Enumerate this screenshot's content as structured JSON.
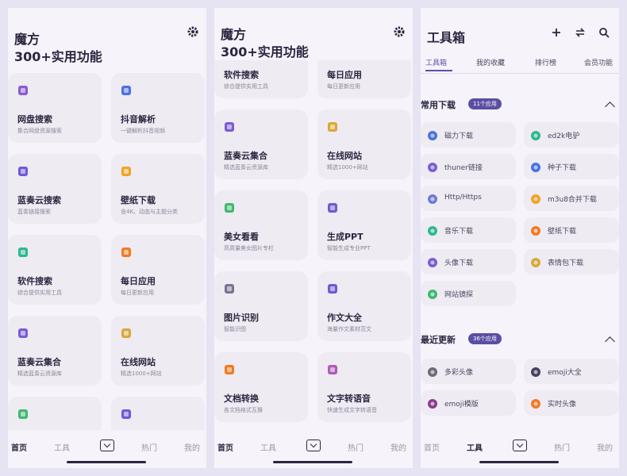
{
  "screen1": {
    "title_line1": "魔方",
    "title_line2": "300+实用功能",
    "cards": [
      {
        "title": "网盘搜索",
        "sub": "集合网盘资源搜索",
        "icon": "inbox-icon",
        "color": "#8a5cd0"
      },
      {
        "title": "抖音解析",
        "sub": "一键解析抖音视频",
        "icon": "music-note-icon",
        "color": "#4a72e0"
      },
      {
        "title": "蓝奏云搜索",
        "sub": "蓝奏链接搜索",
        "icon": "cloud-icon",
        "color": "#6e5ad6"
      },
      {
        "title": "壁纸下载",
        "sub": "含4K、动态与主题分类",
        "icon": "image-icon",
        "color": "#f2a226"
      },
      {
        "title": "软件搜索",
        "sub": "综合提供实用工具",
        "icon": "database-icon",
        "color": "#2cb894"
      },
      {
        "title": "每日应用",
        "sub": "每日更新应用",
        "icon": "cube-icon",
        "color": "#f07a22"
      },
      {
        "title": "蓝奏云集合",
        "sub": "精选蓝奏云资源库",
        "icon": "folder-icon",
        "color": "#7a5cd6"
      },
      {
        "title": "在线网站",
        "sub": "精选1000+网站",
        "icon": "globe-icon",
        "color": "#d8a83a"
      },
      {
        "title": "",
        "sub": "",
        "icon": "eye-icon",
        "color": "#3fb870"
      },
      {
        "title": "",
        "sub": "",
        "icon": "pie-icon",
        "color": "#6e5ad6"
      }
    ],
    "nav": [
      "首页",
      "工具",
      "热门",
      "我的"
    ]
  },
  "screen2": {
    "title_line1": "魔方",
    "title_line2": "300+实用功能",
    "cards": [
      {
        "title": "软件搜索",
        "sub": "综合提供实用工具",
        "icon": "database-icon",
        "color": "#2cb894"
      },
      {
        "title": "每日应用",
        "sub": "每日更新应用",
        "icon": "cube-icon",
        "color": "#f07a22"
      },
      {
        "title": "蓝奏云集合",
        "sub": "精选蓝奏云资源库",
        "icon": "folder-icon",
        "color": "#7a5cd6"
      },
      {
        "title": "在线网站",
        "sub": "精选1000+网站",
        "icon": "globe-icon",
        "color": "#d8a83a"
      },
      {
        "title": "美女看看",
        "sub": "高质量美女图片专栏",
        "icon": "eye-icon",
        "color": "#3fb870"
      },
      {
        "title": "生成PPT",
        "sub": "智能生成专业PPT",
        "icon": "pie-icon",
        "color": "#6e5ad6"
      },
      {
        "title": "图片识别",
        "sub": "智能识图",
        "icon": "scan-icon",
        "color": "#7a7390"
      },
      {
        "title": "作文大全",
        "sub": "海量作文素材范文",
        "icon": "document-icon",
        "color": "#6e5ad6"
      },
      {
        "title": "文档转换",
        "sub": "各文档格式互换",
        "icon": "file-icon",
        "color": "#f07a22"
      },
      {
        "title": "文字转语音",
        "sub": "快速生成文字转语音",
        "icon": "mic-icon",
        "color": "#b05ab8"
      }
    ],
    "nav": [
      "首页",
      "工具",
      "热门",
      "我的"
    ]
  },
  "screen3": {
    "title": "工具箱",
    "tabs": [
      "工具箱",
      "我的收藏",
      "排行榜",
      "会员功能"
    ],
    "section1": {
      "title": "常用下载",
      "badge": "11个应用",
      "items": [
        {
          "label": "磁力下载",
          "icon": "magnet-icon",
          "color": "#4a72e0"
        },
        {
          "label": "ed2k电驴",
          "icon": "medal-icon",
          "color": "#2cb894"
        },
        {
          "label": "thuner链接",
          "icon": "bird-icon",
          "color": "#7a5cd6"
        },
        {
          "label": "种子下载",
          "icon": "cloud-icon",
          "color": "#4a72e0"
        },
        {
          "label": "Http/Https",
          "icon": "globe-icon",
          "color": "#6e7ad6"
        },
        {
          "label": "m3u8合并下载",
          "icon": "video-icon",
          "color": "#f2a226"
        },
        {
          "label": "音乐下载",
          "icon": "music-note-icon",
          "color": "#2cb894"
        },
        {
          "label": "壁纸下载",
          "icon": "image-icon",
          "color": "#f07a22"
        },
        {
          "label": "头像下载",
          "icon": "avatar-icon",
          "color": "#7a5cd6"
        },
        {
          "label": "表情包下载",
          "icon": "emoji-icon",
          "color": "#d8a83a"
        },
        {
          "label": "网站镜探",
          "icon": "globe-icon",
          "color": "#3fb870"
        }
      ]
    },
    "section2": {
      "title": "最近更新",
      "badge": "36个应用",
      "items": [
        {
          "label": "多彩头像",
          "icon": "github-icon",
          "color": "#6e6a7a"
        },
        {
          "label": "emoji大全",
          "icon": "pacman-icon",
          "color": "#4a4060"
        },
        {
          "label": "emoji模版",
          "icon": "pacman-icon",
          "color": "#8a3c8a"
        },
        {
          "label": "实时头像",
          "icon": "avatar-icon",
          "color": "#f07a22"
        }
      ]
    },
    "nav": [
      "首页",
      "工具",
      "热门",
      "我的"
    ]
  }
}
